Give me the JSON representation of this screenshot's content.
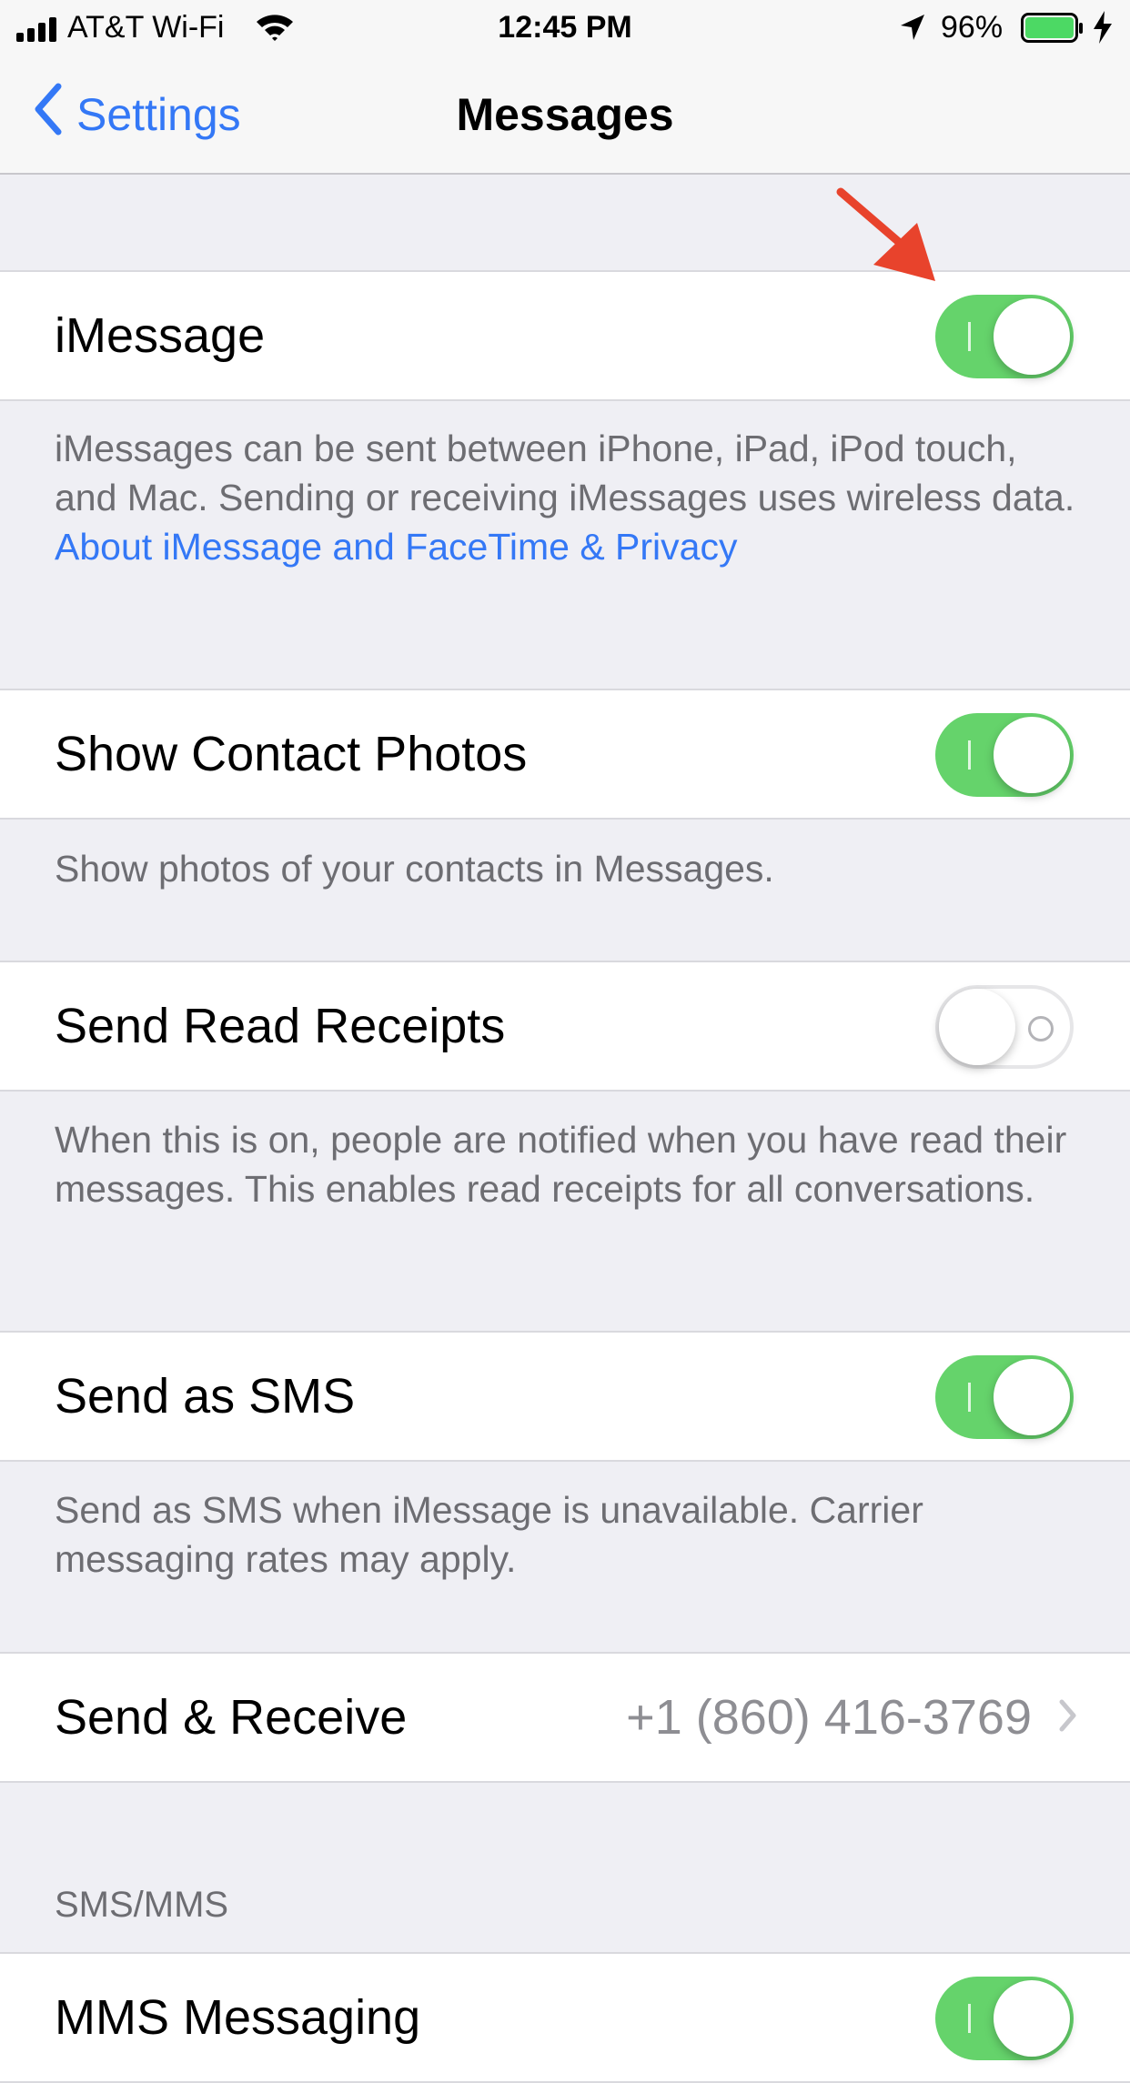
{
  "status_bar": {
    "carrier": "AT&T Wi-Fi",
    "time": "12:45 PM",
    "battery_percent": "96%",
    "battery_level": 0.96,
    "icons": [
      "signal-icon",
      "wifi-icon",
      "location-icon",
      "battery-icon",
      "charging-icon"
    ]
  },
  "nav": {
    "back_label": "Settings",
    "title": "Messages"
  },
  "settings": {
    "imessage": {
      "label": "iMessage",
      "on": true
    },
    "imessage_footer": {
      "text": "iMessages can be sent between iPhone, iPad, iPod touch, and Mac. Sending or receiving iMessages uses wireless data.",
      "link": "About iMessage and FaceTime & Privacy"
    },
    "contact_photos": {
      "label": "Show Contact Photos",
      "on": true
    },
    "contact_photos_footer": "Show photos of your contacts in Messages.",
    "read_receipts": {
      "label": "Send Read Receipts",
      "on": false
    },
    "read_receipts_footer": "When this is on, people are notified when you have read their messages. This enables read receipts for all conversations.",
    "send_as_sms": {
      "label": "Send as SMS",
      "on": true
    },
    "send_as_sms_footer": "Send as SMS when iMessage is unavailable. Carrier messaging rates may apply.",
    "send_receive": {
      "label": "Send & Receive",
      "value": "+1 (860) 416-3769"
    },
    "sms_mms_header": "SMS/MMS",
    "mms_messaging": {
      "label": "MMS Messaging",
      "on": true
    }
  },
  "colors": {
    "accent": "#3478f6",
    "toggle_on": "#65d36b",
    "annotation_arrow": "#e8432c",
    "background": "#efeff4"
  }
}
